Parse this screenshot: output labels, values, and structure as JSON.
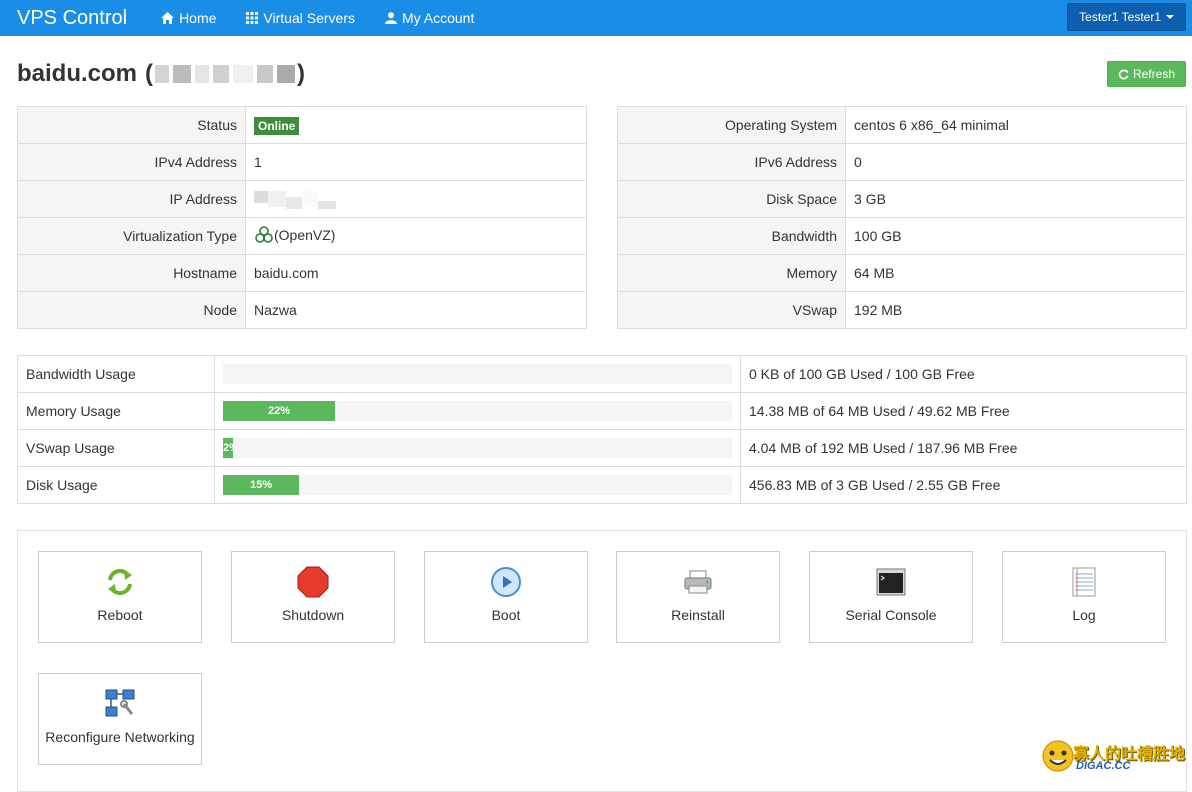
{
  "nav": {
    "brand": "VPS Control",
    "links": [
      {
        "label": "Home",
        "icon": "home-icon"
      },
      {
        "label": "Virtual Servers",
        "icon": "grid-icon"
      },
      {
        "label": "My Account",
        "icon": "user-icon"
      }
    ],
    "user": "Tester1 Tester1"
  },
  "page": {
    "title": "baidu.com",
    "title_open": "(",
    "title_close": ")",
    "refresh": "Refresh"
  },
  "info_left": [
    {
      "key": "Status",
      "value": "Online"
    },
    {
      "key": "IPv4 Address",
      "value": "1"
    },
    {
      "key": "IP Address",
      "value": ""
    },
    {
      "key": "Virtualization Type",
      "value": "(OpenVZ)"
    },
    {
      "key": "Hostname",
      "value": "baidu.com"
    },
    {
      "key": "Node",
      "value": "Nazwa"
    }
  ],
  "info_right": [
    {
      "key": "Operating System",
      "value": "centos 6 x86_64 minimal"
    },
    {
      "key": "IPv6 Address",
      "value": "0"
    },
    {
      "key": "Disk Space",
      "value": "3 GB"
    },
    {
      "key": "Bandwidth",
      "value": "100 GB"
    },
    {
      "key": "Memory",
      "value": "64 MB"
    },
    {
      "key": "VSwap",
      "value": "192 MB"
    }
  ],
  "usage": [
    {
      "label": "Bandwidth Usage",
      "percent": 0,
      "percent_label": "0%",
      "detail": "0 KB of 100 GB Used / 100 GB Free"
    },
    {
      "label": "Memory Usage",
      "percent": 22,
      "percent_label": "22%",
      "detail": "14.38 MB of 64 MB Used / 49.62 MB Free"
    },
    {
      "label": "VSwap Usage",
      "percent": 2,
      "percent_label": "2%",
      "detail": "4.04 MB of 192 MB Used / 187.96 MB Free"
    },
    {
      "label": "Disk Usage",
      "percent": 15,
      "percent_label": "15%",
      "detail": "456.83 MB of 3 GB Used / 2.55 GB Free"
    }
  ],
  "actions": [
    {
      "label": "Reboot",
      "icon": "reboot-icon"
    },
    {
      "label": "Shutdown",
      "icon": "stop-icon"
    },
    {
      "label": "Boot",
      "icon": "play-icon"
    },
    {
      "label": "Reinstall",
      "icon": "printer-icon"
    },
    {
      "label": "Serial Console",
      "icon": "terminal-icon"
    },
    {
      "label": "Log",
      "icon": "notepad-icon"
    },
    {
      "label": "Reconfigure Networking",
      "icon": "network-icon"
    }
  ],
  "watermark": {
    "line1": "寡人的吐槽胜地",
    "line2": "DIGAC.CC"
  },
  "colors": {
    "navbar": "#1a8ee6",
    "success": "#5cb85c",
    "badge": "#3c8d3c",
    "user_button": "#0e5fb0"
  }
}
